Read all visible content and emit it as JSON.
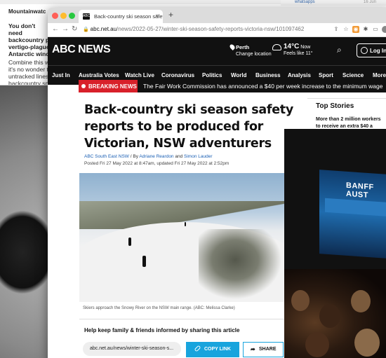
{
  "back_window": {
    "title": "Mountainwatc",
    "body_bold": "You don't need backcountry p vertigo-plague Antarctic wind",
    "body": "Combine this w it's no wonder t untracked lines backcountry sn",
    "top_right_link": "whatsapps",
    "top_right_meta": "16 Jun"
  },
  "browser": {
    "tab_title": "Back-country ski season safet",
    "tab_favicon": "ABC",
    "url_host": "abc.net.au",
    "url_path": "/news/2022-05-27/winter-ski-season-safety-reports-victoria-nsw/101097462"
  },
  "abc_header": {
    "logo": "ABC NEWS",
    "location_name": "Perth",
    "location_action": "Change location",
    "temperature": "14°C",
    "temp_label": "Now",
    "feels_like": "Feels like 11°",
    "login_label": "Log In"
  },
  "nav": [
    "Just In",
    "Australia Votes",
    "Watch Live",
    "Coronavirus",
    "Politics",
    "World",
    "Business",
    "Analysis",
    "Sport",
    "Science",
    "More"
  ],
  "breaking": {
    "tag": "BREAKING NEWS",
    "text": "The Fair Work Commission has announced a $40 per week increase to the minimum wage"
  },
  "article": {
    "headline": "Back-country ski season safety reports to be produced for Victorian, NSW adventurers",
    "source": "ABC South East NSW",
    "by_prefix": " / By ",
    "author1": "Adriane Reardon",
    "and": " and ",
    "author2": "Simon Lauder",
    "posted": "Posted Fri 27 May 2022 at 8:47am, updated Fri 27 May 2022 at 2:52pm",
    "caption": "Skiers approach the Snowy River on the NSW main range. (ABC: Melissa Clarke)"
  },
  "share": {
    "title": "Help keep family & friends informed by sharing this article",
    "url": "abc.net.au/news/winter-ski-season-s...",
    "copy_label": "COPY LINK",
    "share_label": "SHARE"
  },
  "top_stories": {
    "title": "Top Stories",
    "item": "More than 2 million workers to receive an extra $40 a"
  },
  "overlay_photo": {
    "screen_text": "BANFF AUST"
  }
}
